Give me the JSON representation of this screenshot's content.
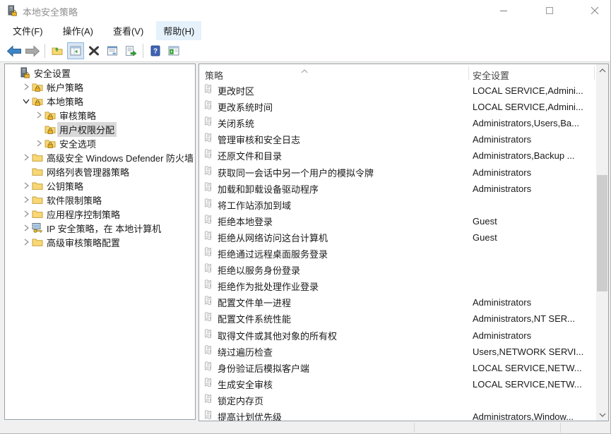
{
  "window": {
    "title": "本地安全策略",
    "controls": [
      "minimize-icon",
      "maximize-icon",
      "close-icon"
    ]
  },
  "menu": {
    "items": [
      {
        "label": "文件(F)",
        "highlight": false
      },
      {
        "label": "操作(A)",
        "highlight": false
      },
      {
        "label": "查看(V)",
        "highlight": false
      },
      {
        "label": "帮助(H)",
        "highlight": true
      }
    ]
  },
  "toolbar": {
    "buttons": [
      {
        "name": "back-button",
        "icon": "back-icon",
        "active": false
      },
      {
        "name": "forward-button",
        "icon": "forward-icon",
        "active": false
      },
      {
        "name": "separator"
      },
      {
        "name": "up-one-level-button",
        "icon": "folder-up-icon",
        "active": false
      },
      {
        "name": "show-hide-console-tree-button",
        "icon": "console-tree-icon",
        "active": true
      },
      {
        "name": "delete-button",
        "icon": "delete-x-icon",
        "active": false
      },
      {
        "name": "properties-button",
        "icon": "properties-icon",
        "active": false
      },
      {
        "name": "export-list-button",
        "icon": "export-list-icon",
        "active": false
      },
      {
        "name": "separator"
      },
      {
        "name": "help-button",
        "icon": "help-icon",
        "active": false
      },
      {
        "name": "show-action-pane-button",
        "icon": "action-pane-icon",
        "active": false
      }
    ]
  },
  "tree": {
    "items": [
      {
        "label": "安全设置",
        "level": 0,
        "expander": "none",
        "icon": "server-lock-icon",
        "selected": false
      },
      {
        "label": "帐户策略",
        "level": 1,
        "expander": "collapsed",
        "icon": "folder-lock-icon",
        "selected": false
      },
      {
        "label": "本地策略",
        "level": 1,
        "expander": "expanded",
        "icon": "folder-lock-icon",
        "selected": false
      },
      {
        "label": "审核策略",
        "level": 2,
        "expander": "collapsed",
        "icon": "folder-lock-icon",
        "selected": false
      },
      {
        "label": "用户权限分配",
        "level": 2,
        "expander": "none",
        "icon": "folder-lock-icon",
        "selected": true
      },
      {
        "label": "安全选项",
        "level": 2,
        "expander": "collapsed",
        "icon": "folder-lock-icon",
        "selected": false
      },
      {
        "label": "高级安全 Windows Defender 防火墙",
        "level": 1,
        "expander": "collapsed",
        "icon": "folder-icon",
        "selected": false
      },
      {
        "label": "网络列表管理器策略",
        "level": 1,
        "expander": "none",
        "icon": "folder-icon",
        "selected": false
      },
      {
        "label": "公钥策略",
        "level": 1,
        "expander": "collapsed",
        "icon": "folder-icon",
        "selected": false
      },
      {
        "label": "软件限制策略",
        "level": 1,
        "expander": "collapsed",
        "icon": "folder-icon",
        "selected": false
      },
      {
        "label": "应用程序控制策略",
        "level": 1,
        "expander": "collapsed",
        "icon": "folder-icon",
        "selected": false
      },
      {
        "label": "IP 安全策略，在 本地计算机",
        "level": 1,
        "expander": "collapsed",
        "icon": "ip-policy-icon",
        "selected": false
      },
      {
        "label": "高级审核策略配置",
        "level": 1,
        "expander": "collapsed",
        "icon": "folder-icon",
        "selected": false
      }
    ]
  },
  "list": {
    "columns": [
      "策略",
      "安全设置"
    ],
    "rows": [
      {
        "policy": "更改时区",
        "setting": "LOCAL SERVICE,Admini..."
      },
      {
        "policy": "更改系统时间",
        "setting": "LOCAL SERVICE,Admini..."
      },
      {
        "policy": "关闭系统",
        "setting": "Administrators,Users,Ba..."
      },
      {
        "policy": "管理审核和安全日志",
        "setting": "Administrators"
      },
      {
        "policy": "还原文件和目录",
        "setting": "Administrators,Backup ..."
      },
      {
        "policy": "获取同一会话中另一个用户的模拟令牌",
        "setting": "Administrators"
      },
      {
        "policy": "加载和卸载设备驱动程序",
        "setting": "Administrators"
      },
      {
        "policy": "将工作站添加到域",
        "setting": ""
      },
      {
        "policy": "拒绝本地登录",
        "setting": "Guest"
      },
      {
        "policy": "拒绝从网络访问这台计算机",
        "setting": "Guest"
      },
      {
        "policy": "拒绝通过远程桌面服务登录",
        "setting": ""
      },
      {
        "policy": "拒绝以服务身份登录",
        "setting": ""
      },
      {
        "policy": "拒绝作为批处理作业登录",
        "setting": ""
      },
      {
        "policy": "配置文件单一进程",
        "setting": "Administrators"
      },
      {
        "policy": "配置文件系统性能",
        "setting": "Administrators,NT SER..."
      },
      {
        "policy": "取得文件或其他对象的所有权",
        "setting": "Administrators"
      },
      {
        "policy": "绕过遍历检查",
        "setting": "Users,NETWORK SERVI..."
      },
      {
        "policy": "身份验证后模拟客户端",
        "setting": "LOCAL SERVICE,NETW..."
      },
      {
        "policy": "生成安全审核",
        "setting": "LOCAL SERVICE,NETW..."
      },
      {
        "policy": "锁定内存页",
        "setting": ""
      },
      {
        "policy": "提高计划优先级",
        "setting": "Administrators,Window..."
      }
    ]
  },
  "colors": {
    "toolbar_active_bg": "#d8e6f2",
    "toolbar_active_border": "#8ab6e0",
    "selection_inactive": "#d9d9d9",
    "pane_border": "#9aa0a6",
    "folder_fill": "#f8d775",
    "folder_stroke": "#c9a23e",
    "lock_gold": "#f0b429",
    "back_arrow_blue": "#3d86c6",
    "forward_arrow_gray": "#a9a9a9",
    "help_blue": "#3f63b4",
    "green_accent": "#35a435"
  }
}
